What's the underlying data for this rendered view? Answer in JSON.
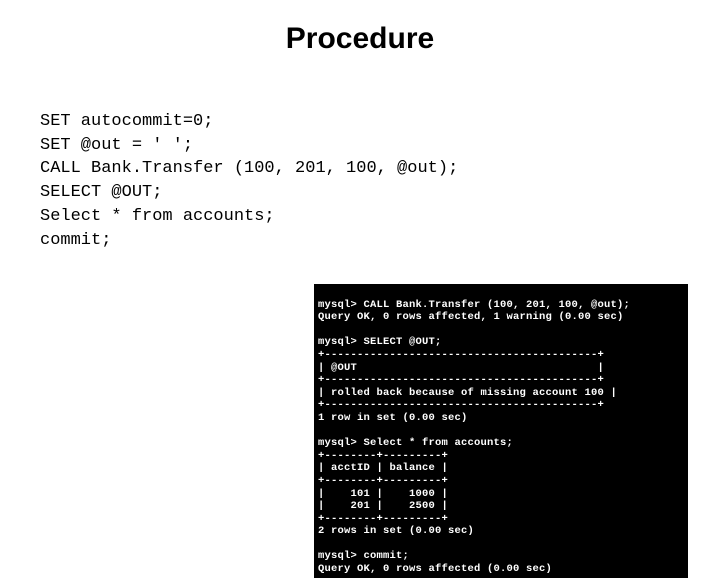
{
  "title": "Procedure",
  "code": {
    "l1": "SET autocommit=0;",
    "l2": "SET @out = ' ';",
    "l3": "CALL Bank.Transfer (100, 201, 100, @out);",
    "l4": "SELECT @OUT;",
    "l5": "Select * from accounts;",
    "l6": "commit;"
  },
  "term": {
    "l1": "mysql> CALL Bank.Transfer (100, 201, 100, @out);",
    "l2": "Query OK, 0 rows affected, 1 warning (0.00 sec)",
    "blank1": "",
    "l3": "mysql> SELECT @OUT;",
    "l4": "+------------------------------------------+",
    "l5": "| @OUT                                     |",
    "l6": "+------------------------------------------+",
    "l7": "| rolled back because of missing account 100 |",
    "l8": "+------------------------------------------+",
    "l9": "1 row in set (0.00 sec)",
    "blank2": "",
    "l10": "mysql> Select * from accounts;",
    "l11": "+--------+---------+",
    "l12": "| acctID | balance |",
    "l13": "+--------+---------+",
    "l14": "|    101 |    1000 |",
    "l15": "|    201 |    2500 |",
    "l16": "+--------+---------+",
    "l17": "2 rows in set (0.00 sec)",
    "blank3": "",
    "l18": "mysql> commit;",
    "l19": "Query OK, 0 rows affected (0.00 sec)"
  }
}
